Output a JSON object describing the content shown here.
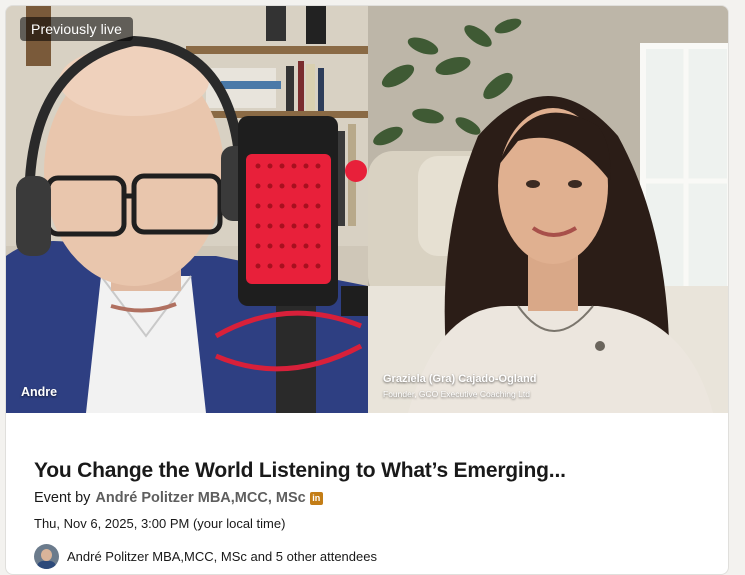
{
  "live_label": "Previously live",
  "left_speaker": {
    "name": "Andre"
  },
  "right_speaker": {
    "name": "Graziela (Gra) Cajado-Ogland",
    "subtitle": "Founder, GCO Executive Coaching Ltd"
  },
  "event": {
    "title": "You Change the World Listening to What’s Emerging...",
    "event_by_prefix": "Event by",
    "organizer": "André Politzer MBA,MCC, MSc",
    "linkedin_badge": "in",
    "datetime": "Thu, Nov 6, 2025, 3:00 PM (your local time)",
    "attendees_text": "André Politzer MBA,MCC, MSc and 5 other attendees"
  },
  "colors": {
    "microphone_red": "#e8203a",
    "badge_gold": "#c37d16",
    "organizer_gray": "#5e5e5e"
  }
}
